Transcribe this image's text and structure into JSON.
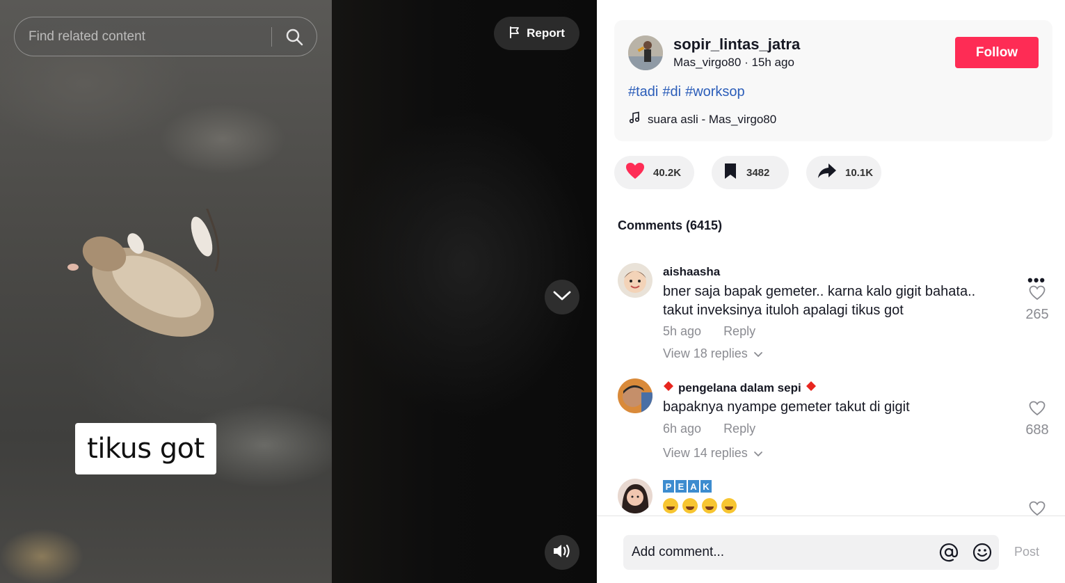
{
  "search": {
    "placeholder": "Find related content"
  },
  "report": {
    "label": "Report"
  },
  "video": {
    "caption": "tikus got"
  },
  "author": {
    "username": "sopir_lintas_jatra",
    "nickname": "Mas_virgo80",
    "time": "15h ago",
    "follow_label": "Follow"
  },
  "description": {
    "hashtags": [
      "#tadi",
      "#di",
      "#worksop"
    ]
  },
  "music": {
    "label": "suara asli - Mas_virgo80"
  },
  "stats": {
    "likes": "40.2K",
    "saves": "3482",
    "shares": "10.1K"
  },
  "comments_header": "Comments (6415)",
  "comments": [
    {
      "user": "aishaasha",
      "text": "bner saja bapak gemeter.. karna kalo gigit bahata.. takut inveksinya ituloh apalagi tikus got",
      "time": "5h ago",
      "reply_label": "Reply",
      "view_replies": "View 18 replies",
      "likes": "265"
    },
    {
      "user": "pengelana dalam sepi",
      "text": "bapaknya nyampe gemeter takut di gigit",
      "time": "6h ago",
      "reply_label": "Reply",
      "view_replies": "View 14 replies",
      "likes": "688"
    },
    {
      "user_badge_letters": [
        "P",
        "E",
        "A",
        "K"
      ],
      "emoji_count": 4
    }
  ],
  "comment_bar": {
    "placeholder": "Add comment...",
    "post_label": "Post"
  },
  "colors": {
    "follow": "#fe2c55",
    "hashtag": "#2b5db9",
    "like_heart": "#fe2c55"
  }
}
